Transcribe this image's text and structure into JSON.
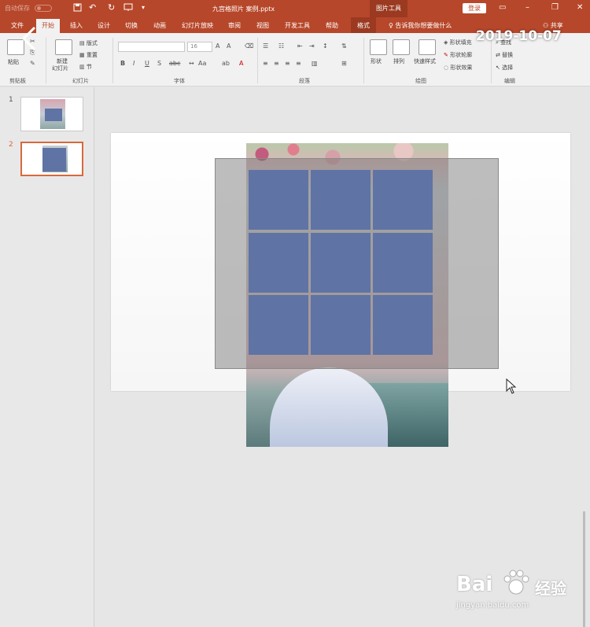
{
  "titlebar": {
    "autosave_label": "自动保存",
    "autosave_state": "关",
    "document_title": "九宫格照片 案例.pptx",
    "contextual_tools": "图片工具",
    "login_label": "登录"
  },
  "tabs": [
    "文件",
    "开始",
    "插入",
    "设计",
    "切换",
    "动画",
    "幻灯片放映",
    "审阅",
    "视图",
    "开发工具",
    "帮助",
    "格式"
  ],
  "active_tab": "开始",
  "tell_me": "告诉我你想要做什么",
  "share_label": "共享",
  "date_stamp": "2019-10-07",
  "ribbon": {
    "clipboard": {
      "paste": "粘贴",
      "label": "剪贴板"
    },
    "slides": {
      "new_slide_top": "新建",
      "new_slide_bottom": "幻灯片",
      "layout": "版式",
      "reset": "重置",
      "section": "节",
      "label": "幻灯片"
    },
    "font": {
      "font_size": "16",
      "label": "字体"
    },
    "paragraph": {
      "label": "段落"
    },
    "drawing": {
      "shapes": "形状",
      "arrange": "排列",
      "quick_styles": "快速样式",
      "fill": "形状填充",
      "outline": "形状轮廓",
      "effects": "形状效果",
      "label": "绘图"
    },
    "editing": {
      "find": "查找",
      "replace": "替换",
      "select": "选择",
      "label": "编辑"
    }
  },
  "slides_panel": [
    {
      "number": "1",
      "selected": false
    },
    {
      "number": "2",
      "selected": true
    }
  ],
  "grid": {
    "rows": 3,
    "cols": 3,
    "cell_color": "#5f73a4"
  },
  "colors": {
    "accent": "#b7472a",
    "tab_dark": "#9b3a21",
    "selection": "#d9683c"
  },
  "watermark": {
    "brand": "Bai",
    "brand_cn": "经验",
    "url": "jingyan.baidu.com"
  }
}
